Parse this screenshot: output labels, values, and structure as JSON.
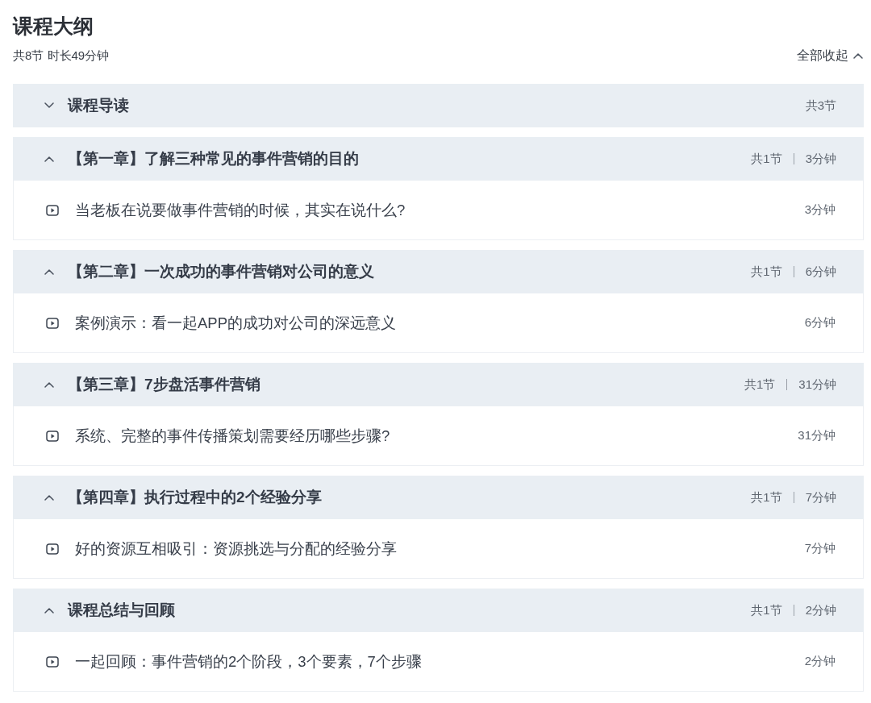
{
  "title": "课程大纲",
  "summary": "共8节 时长49分钟",
  "collapse_all": {
    "label": "全部收起"
  },
  "sections": [
    {
      "title": "课程导读",
      "expanded": false,
      "lesson_count": "共3节"
    },
    {
      "title": "【第一章】了解三种常见的事件营销的目的",
      "expanded": true,
      "lesson_count": "共1节",
      "duration": "3分钟",
      "lessons": [
        {
          "title": "当老板在说要做事件营销的时候，其实在说什么?",
          "duration": "3分钟"
        }
      ]
    },
    {
      "title": "【第二章】一次成功的事件营销对公司的意义",
      "expanded": true,
      "lesson_count": "共1节",
      "duration": "6分钟",
      "lessons": [
        {
          "title": "案例演示：看一起APP的成功对公司的深远意义",
          "duration": "6分钟"
        }
      ]
    },
    {
      "title": "【第三章】7步盘活事件营销",
      "expanded": true,
      "lesson_count": "共1节",
      "duration": "31分钟",
      "lessons": [
        {
          "title": "系统、完整的事件传播策划需要经历哪些步骤?",
          "duration": "31分钟"
        }
      ]
    },
    {
      "title": "【第四章】执行过程中的2个经验分享",
      "expanded": true,
      "lesson_count": "共1节",
      "duration": "7分钟",
      "lessons": [
        {
          "title": "好的资源互相吸引：资源挑选与分配的经验分享",
          "duration": "7分钟"
        }
      ]
    },
    {
      "title": "课程总结与回顾",
      "expanded": true,
      "lesson_count": "共1节",
      "duration": "2分钟",
      "lessons": [
        {
          "title": "一起回顾：事件营销的2个阶段，3个要素，7个步骤",
          "duration": "2分钟"
        }
      ]
    }
  ]
}
